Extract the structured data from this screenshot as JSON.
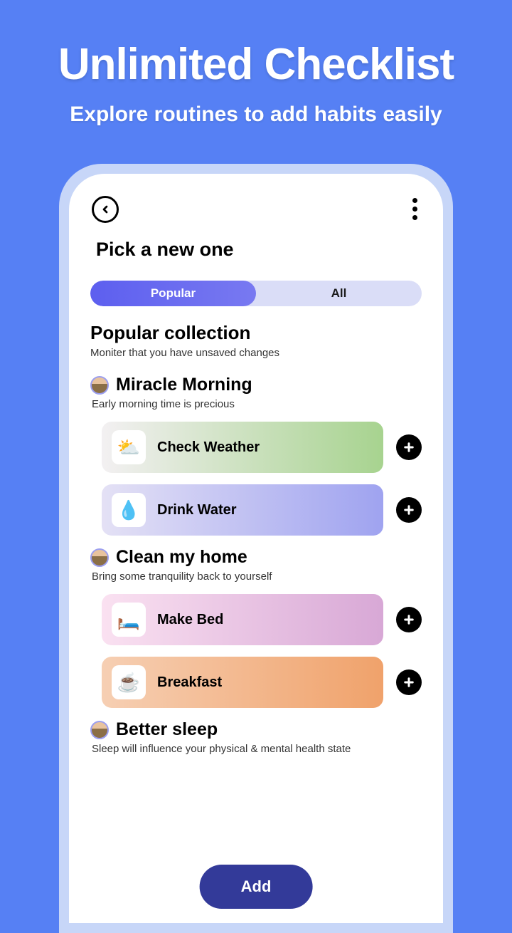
{
  "hero": {
    "title": "Unlimited Checklist",
    "subtitle": "Explore routines to add habits easily"
  },
  "screen": {
    "title": "Pick a new one"
  },
  "tabs": {
    "popular": "Popular",
    "all": "All"
  },
  "section": {
    "title": "Popular collection",
    "subtitle": "Moniter that you have unsaved changes"
  },
  "routines": [
    {
      "title": "Miracle Morning",
      "subtitle": "Early morning time is precious",
      "habits": [
        {
          "label": "Check Weather",
          "icon": "⛅",
          "style": "weather"
        },
        {
          "label": "Drink Water",
          "icon": "💧",
          "style": "water"
        }
      ]
    },
    {
      "title": "Clean my home",
      "subtitle": "Bring some tranquility back to yourself",
      "habits": [
        {
          "label": "Make Bed",
          "icon": "🛏️",
          "style": "bed"
        },
        {
          "label": "Breakfast",
          "icon": "☕",
          "style": "breakfast"
        }
      ]
    },
    {
      "title": "Better sleep",
      "subtitle": "Sleep will influence your physical & mental health state",
      "habits": []
    }
  ],
  "addButton": "Add"
}
